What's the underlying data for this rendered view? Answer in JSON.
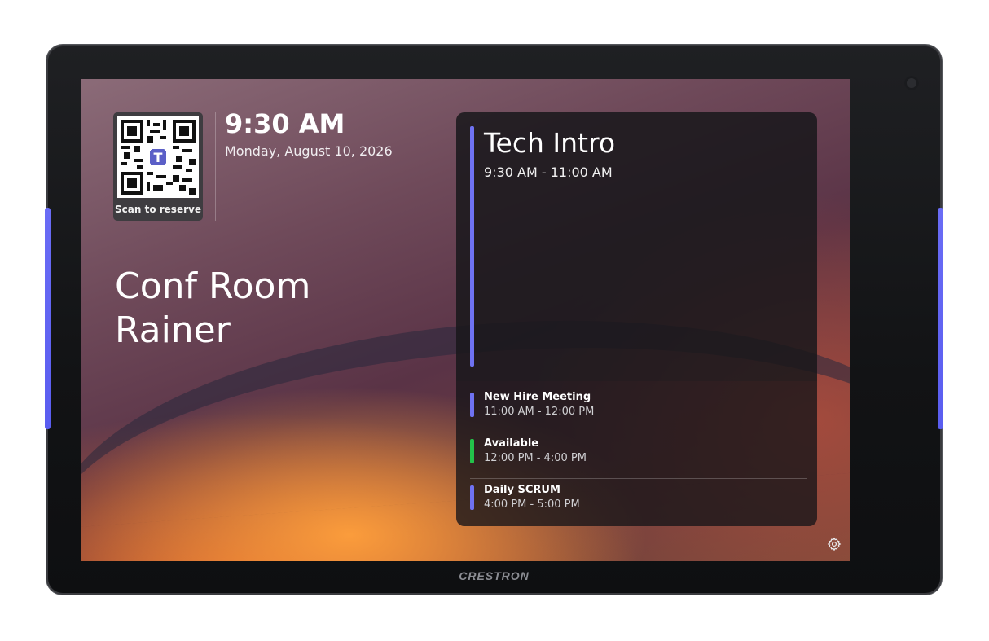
{
  "qr": {
    "label": "Scan to reserve"
  },
  "clock": {
    "time": "9:30 AM",
    "date": "Monday, August 10, 2026"
  },
  "room": {
    "name_line1": "Conf Room",
    "name_line2": "Rainer"
  },
  "current_meeting": {
    "title": "Tech Intro",
    "time": "9:30 AM - 11:00 AM",
    "accent": "#6f72f2"
  },
  "agenda": [
    {
      "name": "New Hire Meeting",
      "time": "11:00 AM - 12:00 PM",
      "color": "#6f72f2"
    },
    {
      "name": "Available",
      "time": "12:00 PM - 4:00 PM",
      "color": "#23c24a"
    },
    {
      "name": "Daily SCRUM",
      "time": "4:00 PM - 5:00 PM",
      "color": "#6f72f2"
    }
  ],
  "device": {
    "brand": "CRESTRON"
  },
  "icons": {
    "settings": "gear-icon",
    "camera": "camera-icon",
    "teams": "teams-logo"
  }
}
